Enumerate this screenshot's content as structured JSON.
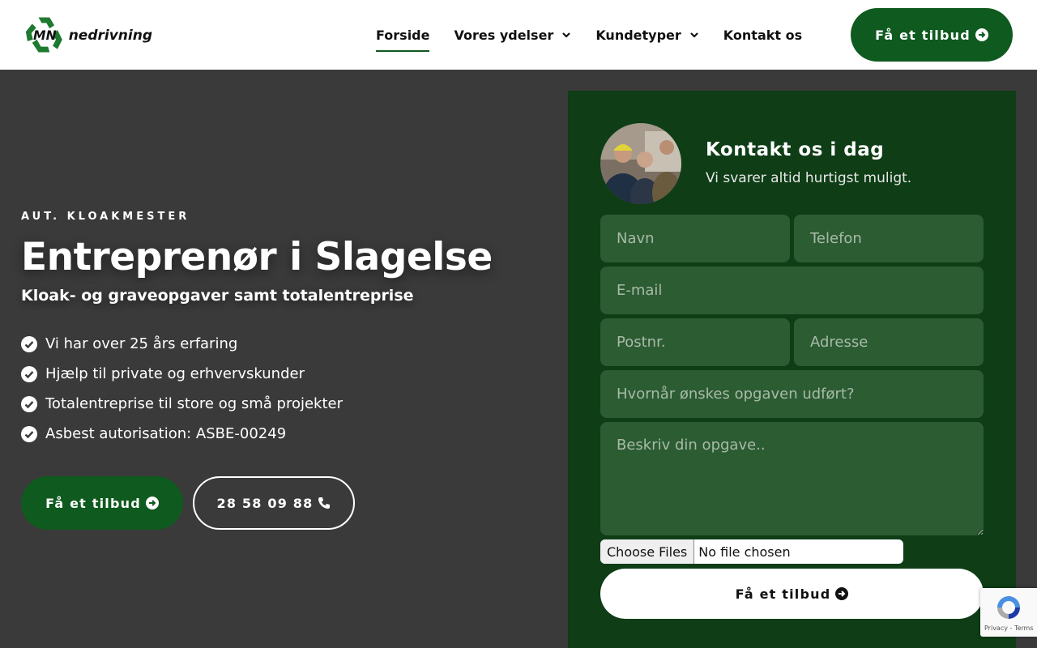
{
  "header": {
    "logo_text": "nedrivning",
    "logo_monogram": "MN",
    "nav": [
      {
        "label": "Forside",
        "active": true,
        "dropdown": false
      },
      {
        "label": "Vores ydelser",
        "active": false,
        "dropdown": true
      },
      {
        "label": "Kundetyper",
        "active": false,
        "dropdown": true
      },
      {
        "label": "Kontakt os",
        "active": false,
        "dropdown": false
      }
    ],
    "cta_label": "Få et tilbud"
  },
  "hero": {
    "eyebrow": "AUT. KLOAKMESTER",
    "title": "Entreprenør i Slagelse",
    "subtitle": "Kloak- og graveopgaver samt totalentreprise",
    "features": [
      "Vi har over 25 års erfaring",
      "Hjælp til private og erhvervskunder",
      "Totalentreprise til store og små projekter",
      "Asbest autorisation: ASBE-00249"
    ],
    "quote_button": "Få et tilbud",
    "phone_button": "28 58 09 88"
  },
  "form": {
    "title": "Kontakt os i dag",
    "subtitle": "Vi svarer altid hurtigst muligt.",
    "fields": {
      "name": "Navn",
      "phone": "Telefon",
      "email": "E-mail",
      "zip": "Postnr.",
      "address": "Adresse",
      "when": "Hvornår ønskes opgaven udført?",
      "description": "Beskriv din opgave.."
    },
    "file_button": "Choose Files",
    "file_status": "No file chosen",
    "submit_label": "Få et tilbud"
  },
  "recaptcha": {
    "text": "Privacy - Terms"
  },
  "colors": {
    "brand_green": "#0f5a1f",
    "panel_green": "#0e3d16",
    "field_green": "#2c5c32",
    "hero_bg": "#3a3a3a"
  }
}
